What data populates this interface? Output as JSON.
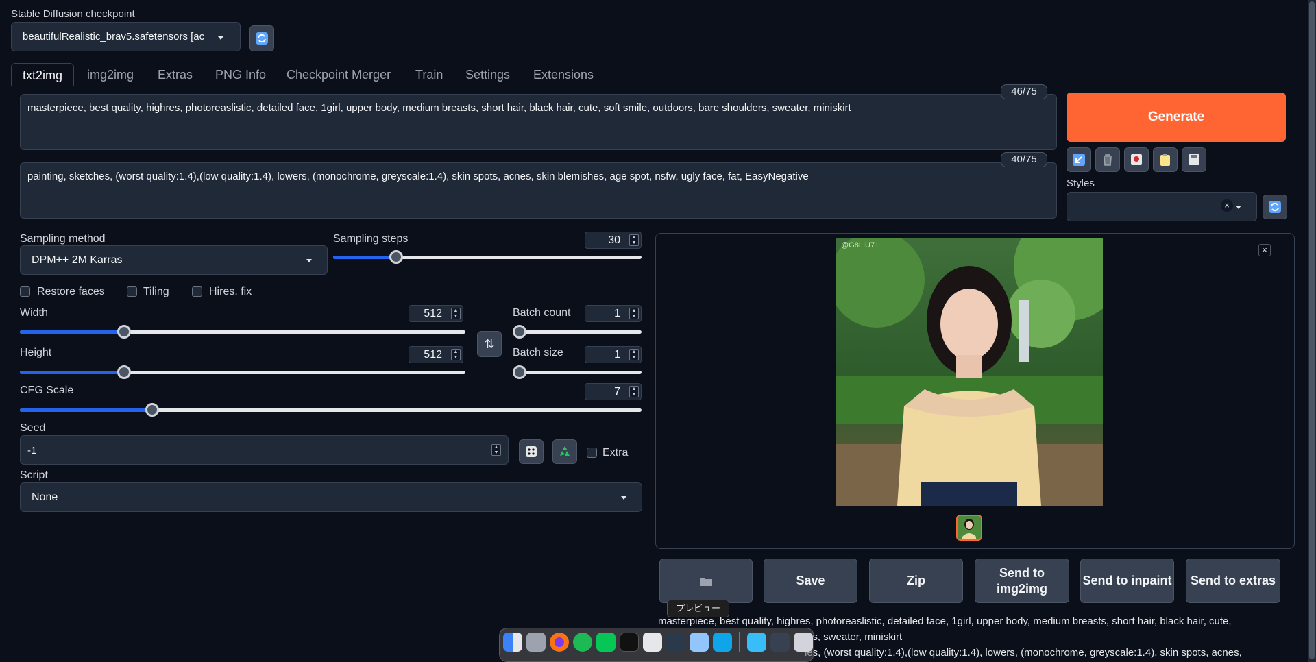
{
  "checkpoint": {
    "label": "Stable Diffusion checkpoint",
    "value": "beautifulRealistic_brav5.safetensors [ac"
  },
  "tabs": [
    {
      "label": "txt2img",
      "active": true
    },
    {
      "label": "img2img"
    },
    {
      "label": "Extras"
    },
    {
      "label": "PNG Info"
    },
    {
      "label": "Checkpoint Merger"
    },
    {
      "label": "Train"
    },
    {
      "label": "Settings"
    },
    {
      "label": "Extensions"
    }
  ],
  "prompt": {
    "positive": "masterpiece, best quality, highres, photoreaslistic, detailed face, 1girl, upper body, medium breasts, short hair, black hair, cute, soft smile, outdoors, bare shoulders, sweater, miniskirt",
    "positive_count": "46/75",
    "negative": "painting, sketches, (worst quality:1.4),(low quality:1.4), lowers, (monochrome, greyscale:1.4), skin spots, acnes, skin blemishes, age spot, nsfw, ugly face, fat, EasyNegative",
    "negative_count": "40/75"
  },
  "generate_label": "Generate",
  "styles_label": "Styles",
  "sampling": {
    "method_label": "Sampling method",
    "method_value": "DPM++ 2M Karras",
    "steps_label": "Sampling steps",
    "steps_value": "30",
    "steps_fraction": 0.19
  },
  "checkboxes": {
    "restore_faces": "Restore faces",
    "tiling": "Tiling",
    "hires_fix": "Hires. fix",
    "extra": "Extra"
  },
  "width": {
    "label": "Width",
    "value": "512",
    "fraction": 0.234
  },
  "height": {
    "label": "Height",
    "value": "512",
    "fraction": 0.234
  },
  "batch_count": {
    "label": "Batch count",
    "value": "1",
    "fraction": 0.0
  },
  "batch_size": {
    "label": "Batch size",
    "value": "1",
    "fraction": 0.0
  },
  "cfg": {
    "label": "CFG Scale",
    "value": "7",
    "fraction": 0.21
  },
  "seed": {
    "label": "Seed",
    "value": "-1"
  },
  "script": {
    "label": "Script",
    "value": "None"
  },
  "actions": {
    "folder_icon": "folder-icon",
    "save": "Save",
    "zip": "Zip",
    "send_img2img": "Send to img2img",
    "send_inpaint": "Send to inpaint",
    "send_extras": "Send to extras"
  },
  "tooltip": "プレビュー",
  "watermark": "@G8LIU7+",
  "output_info": {
    "line1": "masterpiece, best quality, highres, photoreaslistic, detailed face, 1girl, upper body, medium breasts, short hair, black hair, cute,",
    "line2": "ers, sweater, miniskirt",
    "line3": "ies, (worst quality:1.4),(low quality:1.4), lowers, (monochrome, greyscale:1.4), skin spots, acnes,"
  },
  "colors": {
    "accent": "#ff6433",
    "slider": "#2563eb",
    "background": "#0b0f19"
  }
}
